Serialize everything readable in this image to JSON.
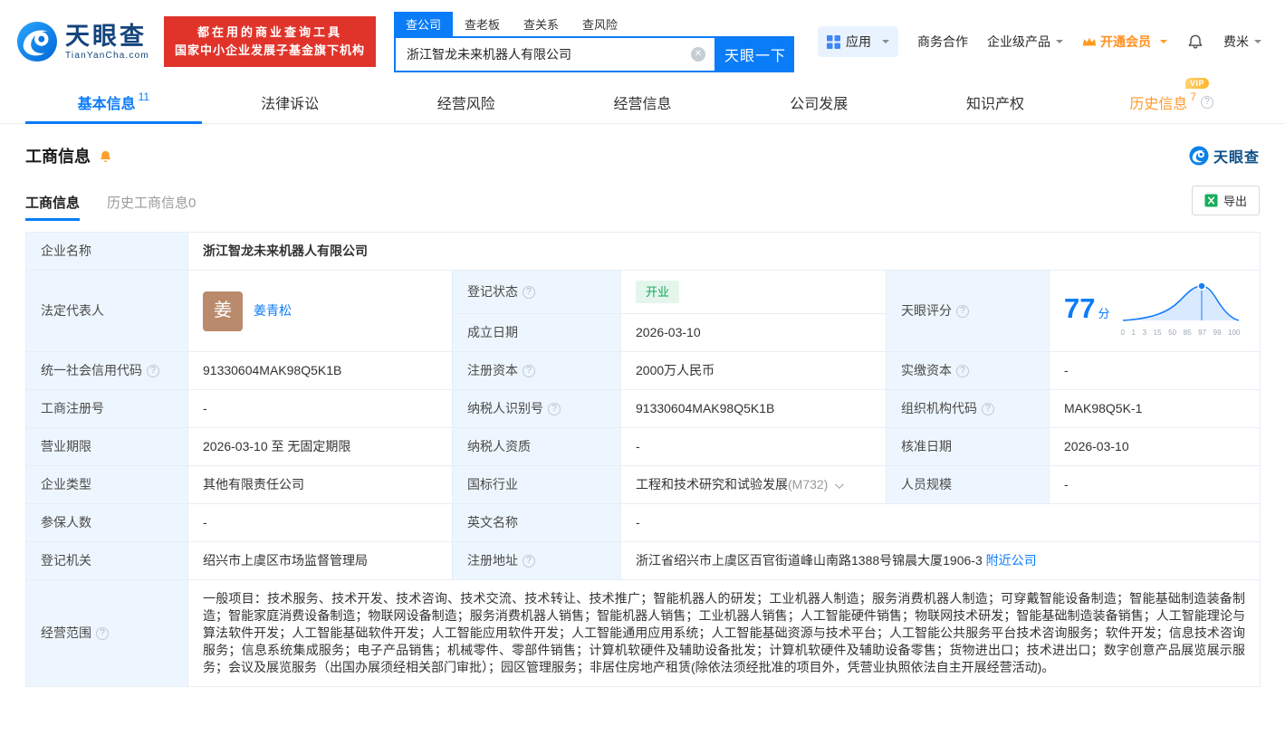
{
  "colors": {
    "accent": "#0a7cf8",
    "brand_red": "#e0342b",
    "vip_orange": "#ff9a2e",
    "success_green": "#10a75c",
    "score_blue": "#177ef7"
  },
  "header": {
    "logo": {
      "brand": "天眼查",
      "domain": "TianYanCha.com"
    },
    "promo": {
      "line1": "都在用的商业查询工具",
      "line2": "国家中小企业发展子基金旗下机构"
    },
    "search": {
      "tabs": [
        {
          "label": "查公司"
        },
        {
          "label": "查老板"
        },
        {
          "label": "查关系"
        },
        {
          "label": "查风险"
        }
      ],
      "value": "浙江智龙未来机器人有限公司",
      "button_label": "天眼一下"
    },
    "menu": {
      "apps": "应用",
      "cooperation": "商务合作",
      "enterprise": "企业级产品",
      "vip": "开通会员",
      "user": "费米"
    }
  },
  "nav": {
    "tabs": [
      {
        "label": "基本信息",
        "count": "11"
      },
      {
        "label": "法律诉讼"
      },
      {
        "label": "经营风险"
      },
      {
        "label": "经营信息"
      },
      {
        "label": "公司发展"
      },
      {
        "label": "知识产权"
      },
      {
        "label": "历史信息",
        "count": "7",
        "badge": "VIP"
      }
    ]
  },
  "section": {
    "title": "工商信息",
    "watermark": "天眼查",
    "subtabs": [
      {
        "label": "工商信息"
      },
      {
        "label": "历史工商信息",
        "count": "0"
      }
    ],
    "export_label": "导出"
  },
  "table": {
    "company_name": {
      "label": "企业名称",
      "value": "浙江智龙未来机器人有限公司"
    },
    "legal_rep": {
      "label": "法定代表人",
      "avatar": "姜",
      "name": "姜青松"
    },
    "reg_status": {
      "label": "登记状态",
      "value": "开业"
    },
    "establish_date": {
      "label": "成立日期",
      "value": "2026-03-10"
    },
    "score": {
      "label": "天眼评分",
      "value": "77",
      "unit": "分",
      "axis": [
        "0",
        "1",
        "3",
        "15",
        "50",
        "85",
        "97",
        "99",
        "100"
      ]
    },
    "credit_code": {
      "label": "统一社会信用代码",
      "value": "91330604MAK98Q5K1B"
    },
    "reg_capital": {
      "label": "注册资本",
      "value": "2000万人民币"
    },
    "paid_capital": {
      "label": "实缴资本",
      "value": "-"
    },
    "reg_number": {
      "label": "工商注册号",
      "value": "-"
    },
    "taxpayer_id": {
      "label": "纳税人识别号",
      "value": "91330604MAK98Q5K1B"
    },
    "org_code": {
      "label": "组织机构代码",
      "value": "MAK98Q5K-1"
    },
    "business_term": {
      "label": "营业期限",
      "value": "2026-03-10 至 无固定期限"
    },
    "taxpayer_quality": {
      "label": "纳税人资质",
      "value": "-"
    },
    "approval_date": {
      "label": "核准日期",
      "value": "2026-03-10"
    },
    "company_type": {
      "label": "企业类型",
      "value": "其他有限责任公司"
    },
    "industry": {
      "label": "国标行业",
      "value": "工程和技术研究和试验发展",
      "code": "(M732)"
    },
    "staff_size": {
      "label": "人员规模",
      "value": "-"
    },
    "insured_count": {
      "label": "参保人数",
      "value": "-"
    },
    "english_name": {
      "label": "英文名称",
      "value": "-"
    },
    "reg_authority": {
      "label": "登记机关",
      "value": "绍兴市上虞区市场监督管理局"
    },
    "reg_address": {
      "label": "注册地址",
      "value": "浙江省绍兴市上虞区百官街道峰山南路1388号锦晨大厦1906-3",
      "nearby": "附近公司"
    },
    "business_scope": {
      "label": "经营范围",
      "value": "一般项目：技术服务、技术开发、技术咨询、技术交流、技术转让、技术推广；智能机器人的研发；工业机器人制造；服务消费机器人制造；可穿戴智能设备制造；智能基础制造装备制造；智能家庭消费设备制造；物联网设备制造；服务消费机器人销售；智能机器人销售；工业机器人销售；人工智能硬件销售；物联网技术研发；智能基础制造装备销售；人工智能理论与算法软件开发；人工智能基础软件开发；人工智能应用软件开发；人工智能通用应用系统；人工智能基础资源与技术平台；人工智能公共服务平台技术咨询服务；软件开发；信息技术咨询服务；信息系统集成服务；电子产品销售；机械零件、零部件销售；计算机软硬件及辅助设备批发；计算机软硬件及辅助设备零售；货物进出口；技术进出口；数字创意产品展览展示服务；会议及展览服务（出国办展须经相关部门审批）；园区管理服务；非居住房地产租赁(除依法须经批准的项目外，凭营业执照依法自主开展经营活动)。"
    }
  }
}
